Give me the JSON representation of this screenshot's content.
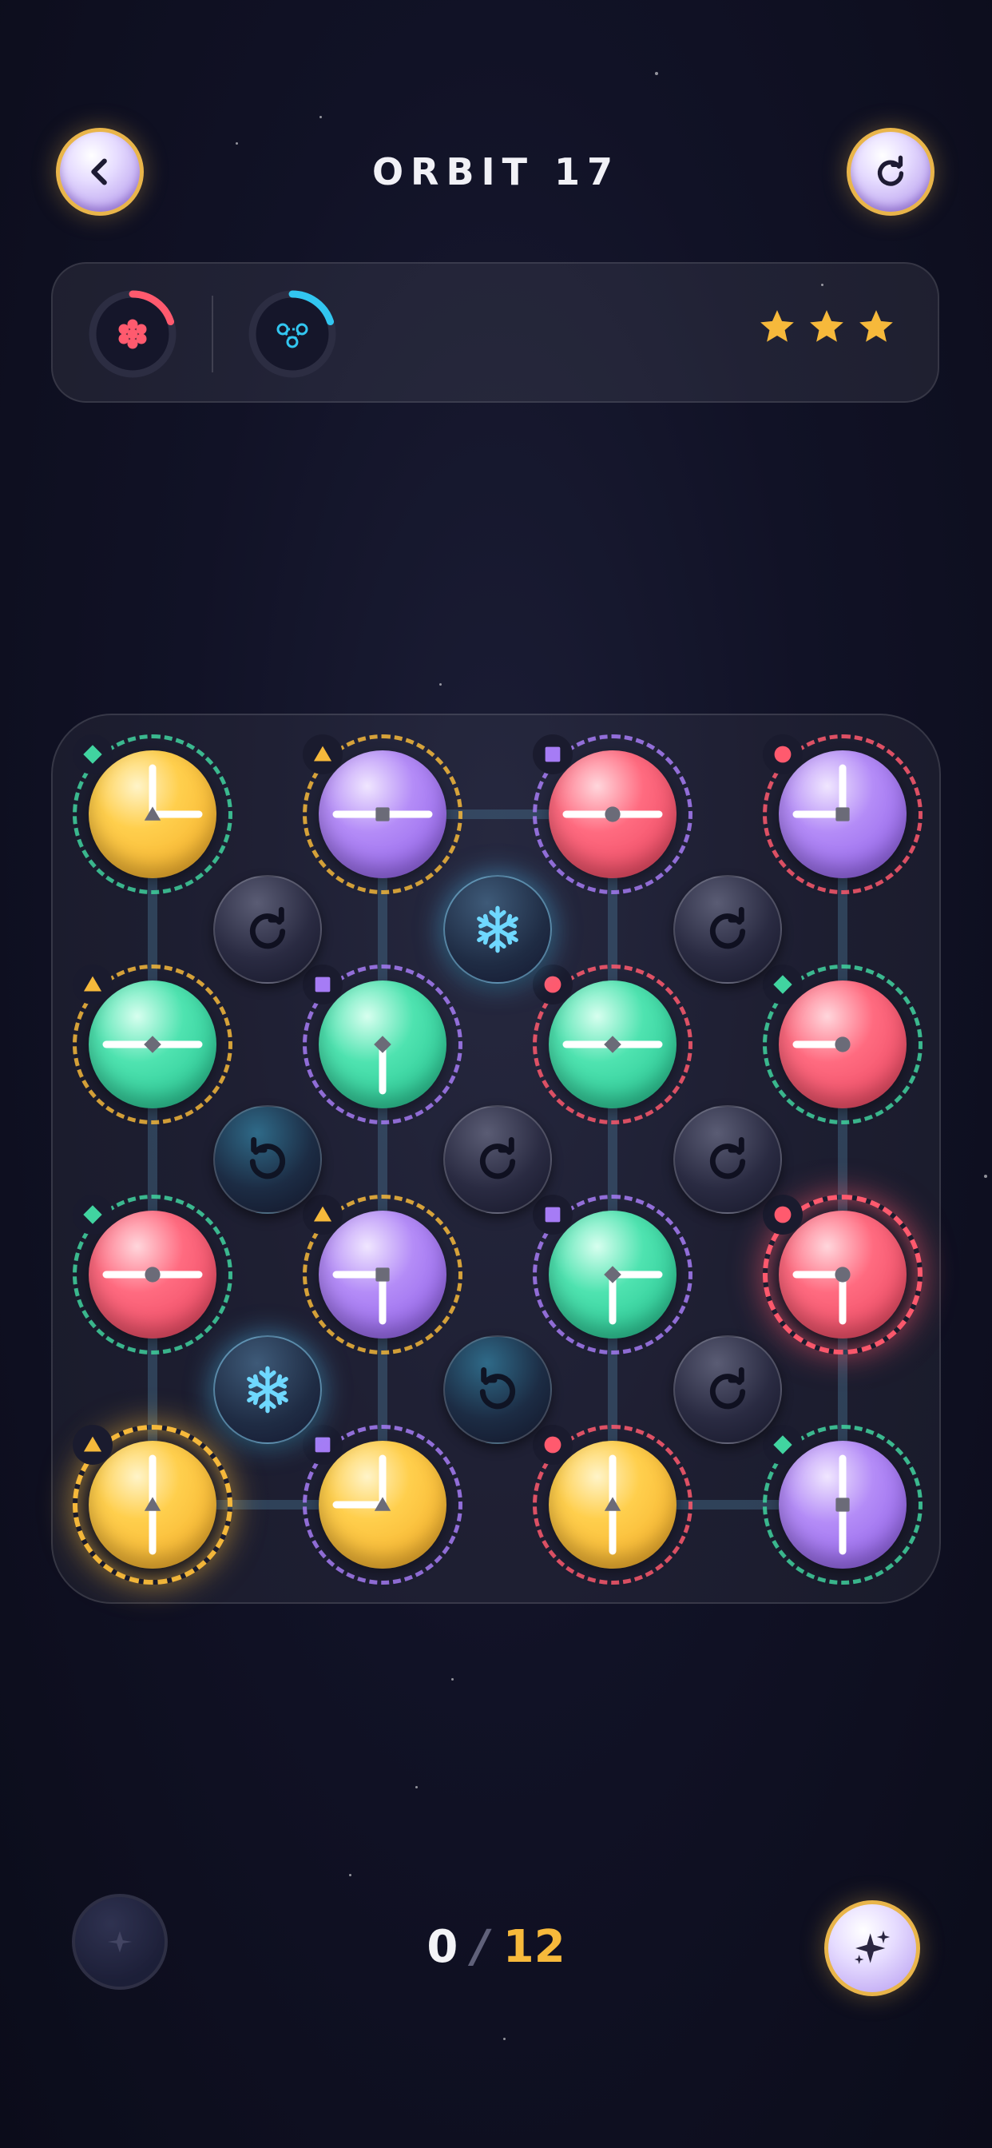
{
  "header": {
    "title": "ORBIT 17",
    "back_icon": "chevron-left-icon",
    "restart_icon": "restart-icon"
  },
  "goals": [
    {
      "icon": "flower-cluster-icon",
      "color": "#ff5a6e",
      "progress": 0.2
    },
    {
      "icon": "network-nodes-icon",
      "color": "#32c6f0",
      "progress": 0.2
    }
  ],
  "rating": {
    "stars": 3,
    "star_color": "#f6b93b"
  },
  "board": {
    "nodes": [
      {
        "row": 0,
        "col": 0,
        "color": "yellow",
        "ring": "green",
        "badge": "diamond",
        "badge_color": "#41d4a0",
        "arms": [
          "up",
          "right"
        ],
        "hub": "triangle",
        "active": false
      },
      {
        "row": 0,
        "col": 1,
        "color": "purple",
        "ring": "yellow",
        "badge": "triangle",
        "badge_color": "#f6b93b",
        "arms": [
          "left",
          "right"
        ],
        "hub": "square",
        "active": false
      },
      {
        "row": 0,
        "col": 2,
        "color": "red",
        "ring": "purple",
        "badge": "square",
        "badge_color": "#a67cf5",
        "arms": [
          "left",
          "right"
        ],
        "hub": "circle",
        "active": false
      },
      {
        "row": 0,
        "col": 3,
        "color": "purple",
        "ring": "red",
        "badge": "circle",
        "badge_color": "#ff5a6e",
        "arms": [
          "up",
          "left"
        ],
        "hub": "square",
        "active": false
      },
      {
        "row": 1,
        "col": 0,
        "color": "green",
        "ring": "yellow",
        "badge": "triangle",
        "badge_color": "#f6b93b",
        "arms": [
          "left",
          "right"
        ],
        "hub": "diamond",
        "active": false
      },
      {
        "row": 1,
        "col": 1,
        "color": "green",
        "ring": "purple",
        "badge": "square",
        "badge_color": "#a67cf5",
        "arms": [
          "down"
        ],
        "hub": "diamond",
        "active": false
      },
      {
        "row": 1,
        "col": 2,
        "color": "green",
        "ring": "red",
        "badge": "circle",
        "badge_color": "#ff5a6e",
        "arms": [
          "left",
          "right"
        ],
        "hub": "diamond",
        "active": false
      },
      {
        "row": 1,
        "col": 3,
        "color": "red",
        "ring": "green",
        "badge": "diamond",
        "badge_color": "#41d4a0",
        "arms": [
          "left"
        ],
        "hub": "circle",
        "active": false
      },
      {
        "row": 2,
        "col": 0,
        "color": "red",
        "ring": "green",
        "badge": "diamond",
        "badge_color": "#41d4a0",
        "arms": [
          "left",
          "right"
        ],
        "hub": "circle",
        "active": false
      },
      {
        "row": 2,
        "col": 1,
        "color": "purple",
        "ring": "yellow",
        "badge": "triangle",
        "badge_color": "#f6b93b",
        "arms": [
          "left",
          "down"
        ],
        "hub": "square",
        "active": false
      },
      {
        "row": 2,
        "col": 2,
        "color": "green",
        "ring": "purple",
        "badge": "square",
        "badge_color": "#a67cf5",
        "arms": [
          "right",
          "down"
        ],
        "hub": "diamond",
        "active": false
      },
      {
        "row": 2,
        "col": 3,
        "color": "red",
        "ring": "red",
        "badge": "circle",
        "badge_color": "#ff5a6e",
        "arms": [
          "left",
          "down"
        ],
        "hub": "circle",
        "active": true
      },
      {
        "row": 3,
        "col": 0,
        "color": "yellow",
        "ring": "yellow",
        "badge": "triangle",
        "badge_color": "#f6b93b",
        "arms": [
          "up",
          "down"
        ],
        "hub": "triangle",
        "active": true
      },
      {
        "row": 3,
        "col": 1,
        "color": "yellow",
        "ring": "purple",
        "badge": "square",
        "badge_color": "#a67cf5",
        "arms": [
          "up",
          "left"
        ],
        "hub": "triangle",
        "active": false
      },
      {
        "row": 3,
        "col": 2,
        "color": "yellow",
        "ring": "red",
        "badge": "circle",
        "badge_color": "#ff5a6e",
        "arms": [
          "up",
          "down"
        ],
        "hub": "triangle",
        "active": false
      },
      {
        "row": 3,
        "col": 3,
        "color": "purple",
        "ring": "green",
        "badge": "diamond",
        "badge_color": "#41d4a0",
        "arms": [
          "up",
          "down"
        ],
        "hub": "square",
        "active": false
      }
    ],
    "rotators": [
      {
        "row": 0,
        "col": 0,
        "type": "cw"
      },
      {
        "row": 0,
        "col": 1,
        "type": "frozen"
      },
      {
        "row": 0,
        "col": 2,
        "type": "cw"
      },
      {
        "row": 1,
        "col": 0,
        "type": "ccw"
      },
      {
        "row": 1,
        "col": 1,
        "type": "cw"
      },
      {
        "row": 1,
        "col": 2,
        "type": "cw"
      },
      {
        "row": 2,
        "col": 0,
        "type": "frozen"
      },
      {
        "row": 2,
        "col": 1,
        "type": "ccw"
      },
      {
        "row": 2,
        "col": 2,
        "type": "cw"
      }
    ],
    "links": {
      "horizontal": [
        [
          0,
          1,
          2
        ],
        [
          3,
          0,
          1
        ],
        [
          3,
          2,
          3
        ]
      ],
      "vertical": [
        [
          0,
          0,
          1
        ],
        [
          1,
          0,
          1
        ],
        [
          2,
          0,
          1
        ],
        [
          3,
          0,
          1
        ],
        [
          0,
          1,
          2
        ],
        [
          1,
          1,
          2
        ],
        [
          2,
          1,
          2
        ],
        [
          3,
          1,
          2
        ],
        [
          0,
          2,
          3
        ],
        [
          1,
          2,
          3
        ],
        [
          2,
          2,
          3
        ],
        [
          3,
          2,
          3
        ]
      ]
    }
  },
  "footer": {
    "moves_current": "0",
    "moves_separator": "/",
    "moves_total": "12",
    "hint_icon": "hint-icon",
    "magic_icon": "sparkles-icon"
  },
  "colors": {
    "yellow": "#f6b93b",
    "purple": "#a67cf5",
    "red": "#ff5a6e",
    "green": "#41d4a0"
  }
}
